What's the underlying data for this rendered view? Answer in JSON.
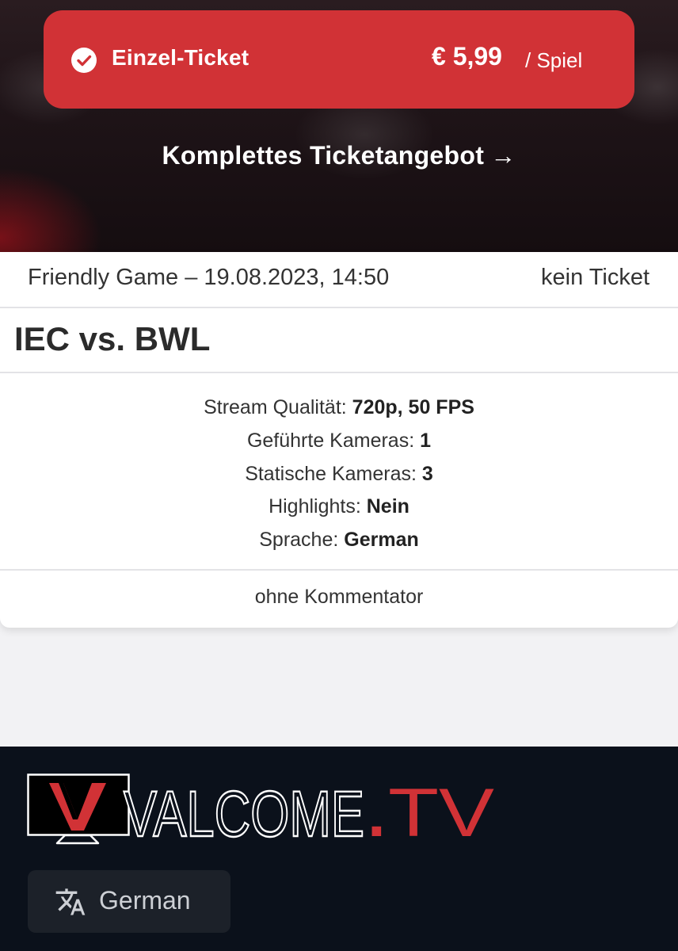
{
  "ticket_option": {
    "name": "Einzel-Ticket",
    "price": "€ 5,99",
    "unit": "/ Spiel",
    "selected": true
  },
  "all_tickets_link": {
    "label": "Komplettes Ticketangebot",
    "arrow": "→"
  },
  "game": {
    "info": "Friendly Game – 19.08.2023, 14:50",
    "ticket_status": "kein Ticket",
    "title": "IEC vs. BWL",
    "details": [
      {
        "label": "Stream Qualität:",
        "value": "720p, 50 FPS"
      },
      {
        "label": "Geführte Kameras:",
        "value": "1"
      },
      {
        "label": "Statische Kameras:",
        "value": "3"
      },
      {
        "label": "Highlights:",
        "value": "Nein"
      },
      {
        "label": "Sprache:",
        "value": "German"
      }
    ],
    "commentary": "ohne Kommentator"
  },
  "footer": {
    "logo": {
      "wordmark": "VALCOME",
      "dot": ".",
      "suffix": "TV"
    },
    "language_button": {
      "label": "German",
      "icon": "translate-icon"
    }
  },
  "colors": {
    "accent_red": "#d13236",
    "footer_bg": "#0b111b",
    "card_bg": "#ffffff",
    "page_bg": "#f2f2f4"
  }
}
